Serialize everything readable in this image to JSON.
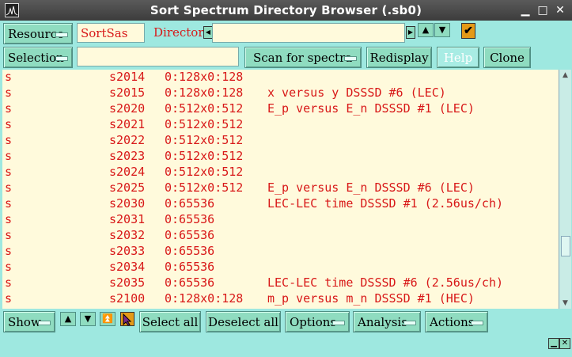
{
  "window": {
    "title": "Sort Spectrum Directory Browser (.sb0)"
  },
  "toolbar": {
    "resource_label": "Resource",
    "resource_value": "SortSas",
    "directory_label": "Directory",
    "directory_value": "",
    "selection_label": "Selection",
    "selection_value": "",
    "scan_label": "Scan for spectra",
    "redisplay_label": "Redisplay",
    "help_label": "Help",
    "clone_label": "Clone"
  },
  "spectra": [
    {
      "type": "s",
      "name": "s2014",
      "size": "0:128x0:128",
      "desc": ""
    },
    {
      "type": "s",
      "name": "s2015",
      "size": "0:128x0:128",
      "desc": "x versus y DSSSD #6 (LEC)"
    },
    {
      "type": "s",
      "name": "s2020",
      "size": "0:512x0:512",
      "desc": "E_p versus E_n DSSSD #1 (LEC)"
    },
    {
      "type": "s",
      "name": "s2021",
      "size": "0:512x0:512",
      "desc": ""
    },
    {
      "type": "s",
      "name": "s2022",
      "size": "0:512x0:512",
      "desc": ""
    },
    {
      "type": "s",
      "name": "s2023",
      "size": "0:512x0:512",
      "desc": ""
    },
    {
      "type": "s",
      "name": "s2024",
      "size": "0:512x0:512",
      "desc": ""
    },
    {
      "type": "s",
      "name": "s2025",
      "size": "0:512x0:512",
      "desc": "E_p versus E_n DSSSD #6 (LEC)"
    },
    {
      "type": "s",
      "name": "s2030",
      "size": "0:65536",
      "desc": "LEC-LEC time DSSSD #1 (2.56us/ch)"
    },
    {
      "type": "s",
      "name": "s2031",
      "size": "0:65536",
      "desc": ""
    },
    {
      "type": "s",
      "name": "s2032",
      "size": "0:65536",
      "desc": ""
    },
    {
      "type": "s",
      "name": "s2033",
      "size": "0:65536",
      "desc": ""
    },
    {
      "type": "s",
      "name": "s2034",
      "size": "0:65536",
      "desc": ""
    },
    {
      "type": "s",
      "name": "s2035",
      "size": "0:65536",
      "desc": "LEC-LEC time DSSSD #6 (2.56us/ch)"
    },
    {
      "type": "s",
      "name": "s2100",
      "size": "0:128x0:128",
      "desc": "m_p versus m_n DSSSD #1 (HEC)"
    }
  ],
  "bottombar": {
    "show_label": "Show",
    "select_all_label": "Select all",
    "deselect_all_label": "Deselect all",
    "options_label": "Options",
    "analysis_label": "Analysis",
    "actions_label": "Actions"
  },
  "colors": {
    "accent": "#d81818",
    "background": "#9ee8e0",
    "field": "#fffadc",
    "button": "#8fdcc0"
  }
}
